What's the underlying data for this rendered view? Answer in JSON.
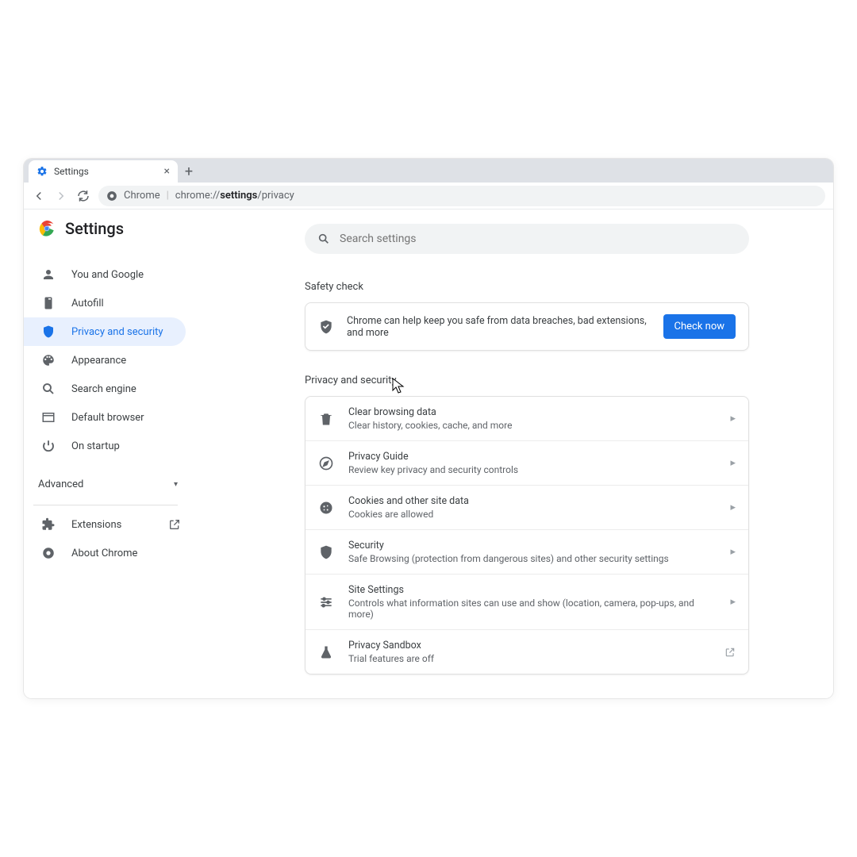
{
  "tab": {
    "title": "Settings"
  },
  "omnibox": {
    "source_label": "Chrome",
    "url_prefix": "chrome://",
    "url_bold": "settings",
    "url_suffix": "/privacy"
  },
  "header": {
    "title": "Settings"
  },
  "search": {
    "placeholder": "Search settings"
  },
  "sidebar": {
    "items": [
      {
        "label": "You and Google",
        "icon": "person"
      },
      {
        "label": "Autofill",
        "icon": "clipboard"
      },
      {
        "label": "Privacy and security",
        "icon": "shield"
      },
      {
        "label": "Appearance",
        "icon": "palette"
      },
      {
        "label": "Search engine",
        "icon": "search"
      },
      {
        "label": "Default browser",
        "icon": "browser"
      },
      {
        "label": "On startup",
        "icon": "power"
      }
    ],
    "advanced_label": "Advanced",
    "footer": [
      {
        "label": "Extensions",
        "icon": "puzzle",
        "external": true
      },
      {
        "label": "About Chrome",
        "icon": "chrome"
      }
    ]
  },
  "safety": {
    "section_title": "Safety check",
    "text": "Chrome can help keep you safe from data breaches, bad extensions, and more",
    "button": "Check now"
  },
  "privacy": {
    "section_title": "Privacy and security",
    "rows": [
      {
        "title": "Clear browsing data",
        "sub": "Clear history, cookies, cache, and more",
        "icon": "trash",
        "action": "chevron"
      },
      {
        "title": "Privacy Guide",
        "sub": "Review key privacy and security controls",
        "icon": "compass",
        "action": "chevron"
      },
      {
        "title": "Cookies and other site data",
        "sub": "Cookies are allowed",
        "icon": "cookie",
        "action": "chevron"
      },
      {
        "title": "Security",
        "sub": "Safe Browsing (protection from dangerous sites) and other security settings",
        "icon": "shield",
        "action": "chevron"
      },
      {
        "title": "Site Settings",
        "sub": "Controls what information sites can use and show (location, camera, pop-ups, and more)",
        "icon": "sliders",
        "action": "chevron"
      },
      {
        "title": "Privacy Sandbox",
        "sub": "Trial features are off",
        "icon": "flask",
        "action": "external"
      }
    ]
  }
}
